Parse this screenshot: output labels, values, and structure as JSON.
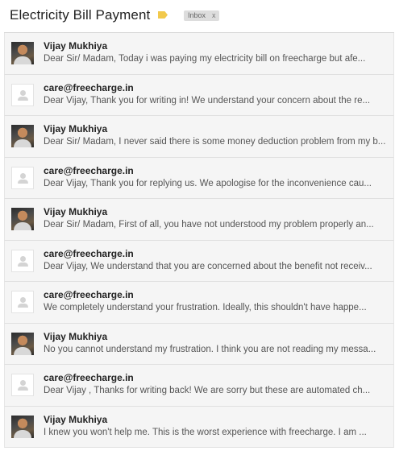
{
  "header": {
    "subject": "Electricity Bill Payment",
    "importance_color": "#f2c94c",
    "label": {
      "text": "Inbox",
      "remove": "x"
    }
  },
  "messages": [
    {
      "sender": "Vijay Mukhiya",
      "avatar": "photo",
      "snippet": "Dear Sir/ Madam, Today i was paying my electricity bill on freecharge but afe..."
    },
    {
      "sender": "care@freecharge.in",
      "avatar": "placeholder-person-icon",
      "snippet": "Dear Vijay, Thank you for writing in! We understand your concern about the re..."
    },
    {
      "sender": "Vijay Mukhiya",
      "avatar": "photo",
      "snippet": "Dear Sir/ Madam, I never said there is some money deduction problem from my b..."
    },
    {
      "sender": "care@freecharge.in",
      "avatar": "placeholder-person-icon",
      "snippet": "Dear Vijay, Thank you for replying us. We apologise for the inconvenience cau..."
    },
    {
      "sender": "Vijay Mukhiya",
      "avatar": "photo",
      "snippet": "Dear Sir/ Madam, First of all, you have not understood my problem properly an..."
    },
    {
      "sender": "care@freecharge.in",
      "avatar": "placeholder-person-icon",
      "snippet": "Dear Vijay, We understand that you are concerned about the benefit not receiv..."
    },
    {
      "sender": "care@freecharge.in",
      "avatar": "placeholder-person-icon",
      "snippet": "We completely understand your frustration. Ideally, this shouldn't have happe..."
    },
    {
      "sender": "Vijay Mukhiya",
      "avatar": "photo",
      "snippet": "No you cannot understand my frustration. I think you are not reading my messa..."
    },
    {
      "sender": "care@freecharge.in",
      "avatar": "placeholder-person-icon",
      "snippet": "Dear Vijay , Thanks for writing back! We are sorry but these are automated ch..."
    },
    {
      "sender": "Vijay Mukhiya",
      "avatar": "photo",
      "snippet": "I knew you won't help me. This is the worst experience with freecharge. I am ..."
    }
  ]
}
